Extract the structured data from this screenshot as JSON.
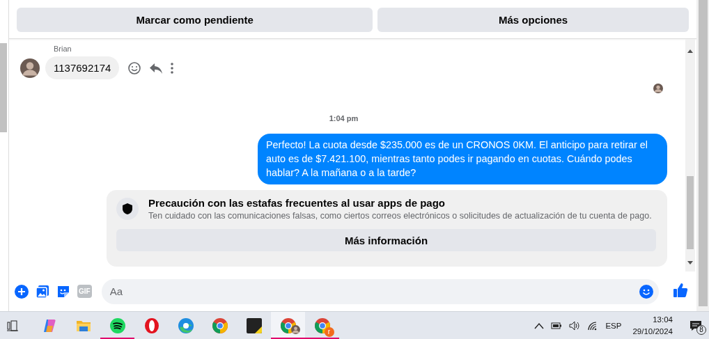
{
  "actions": [
    {
      "label": "Marcar como pendiente"
    },
    {
      "label": "Más opciones"
    }
  ],
  "messages": [
    {
      "kind": "incoming",
      "sender": "Brian",
      "text": "1137692174"
    },
    {
      "kind": "read_receipt"
    },
    {
      "kind": "timestamp",
      "text": "1:04 pm"
    },
    {
      "kind": "outgoing",
      "text": "Perfecto! La cuota desde $235.000 es de un CRONOS 0KM. El anticipo para retirar el auto es de $7.421.100, mientras tanto podes ir pagando en cuotas. Cuándo podes hablar? A la mañana o a la tarde?"
    },
    {
      "kind": "notice",
      "title": "Precaución con las estafas frecuentes al usar apps de pago",
      "body": "Ten cuidado con las comunicaciones falsas, como ciertos correos electrónicos o solicitudes de actualización de tu cuenta de pago.",
      "button": "Más información"
    }
  ],
  "composer": {
    "placeholder": "Aa",
    "gif": "GIF"
  },
  "taskbar": {
    "apps": [
      {
        "kind": "copilot",
        "running": false,
        "active": false
      },
      {
        "kind": "folder",
        "running": false,
        "active": false
      },
      {
        "kind": "spotify",
        "running": true,
        "active": false
      },
      {
        "kind": "opera",
        "running": false,
        "active": false
      },
      {
        "kind": "edge",
        "running": false,
        "active": false
      },
      {
        "kind": "chrome",
        "running": false,
        "active": false
      },
      {
        "kind": "notes",
        "running": false,
        "active": false
      },
      {
        "kind": "chrome-profile",
        "running": true,
        "active": true
      },
      {
        "kind": "chrome-badge",
        "badge": "r",
        "running": true,
        "active": false
      }
    ],
    "language": "ESP",
    "time": "13:04",
    "date": "29/10/2024",
    "notifications": "8"
  }
}
